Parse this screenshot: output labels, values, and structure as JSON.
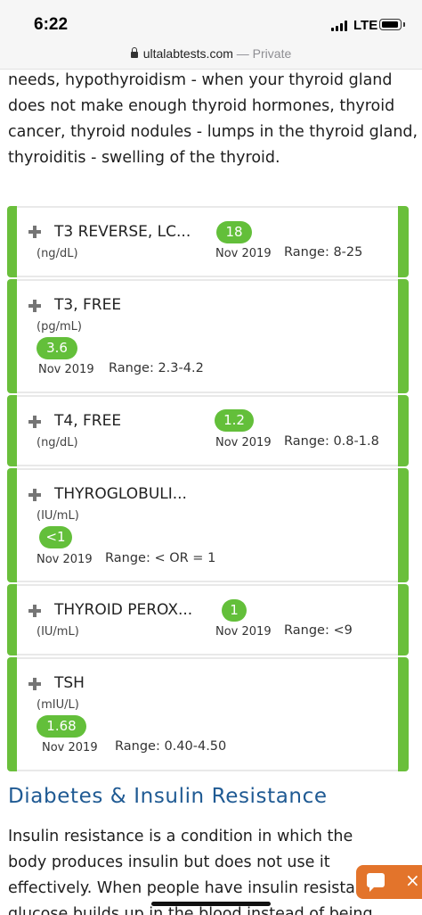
{
  "status_bar": {
    "time": "6:22",
    "network": "LTE"
  },
  "browser": {
    "domain": "ultalabtests.com",
    "mode": "— Private"
  },
  "intro_text": "needs, hypothyroidism - when your thyroid gland does not make enough thyroid hormones, thyroid cancer, thyroid nodules - lumps in the thyroid gland, thyroiditis - swelling of the thyroid.",
  "results": [
    {
      "name": "T3 REVERSE, LC...",
      "unit": "(ng/dL)",
      "value": "18",
      "date": "Nov 2019",
      "range": "Range: 8-25"
    },
    {
      "name": "T3, FREE",
      "unit": "(pg/mL)",
      "value": "3.6",
      "date": "Nov 2019",
      "range": "Range: 2.3-4.2"
    },
    {
      "name": "T4, FREE",
      "unit": "(ng/dL)",
      "value": "1.2",
      "date": "Nov 2019",
      "range": "Range: 0.8-1.8"
    },
    {
      "name": "THYROGLOBULI...",
      "unit": "(IU/mL)",
      "value": "<1",
      "date": "Nov 2019",
      "range": "Range: < OR = 1"
    },
    {
      "name": "THYROID PEROX...",
      "unit": "(IU/mL)",
      "value": "1",
      "date": "Nov 2019",
      "range": "Range: <9"
    },
    {
      "name": "TSH",
      "unit": "(mIU/L)",
      "value": "1.68",
      "date": "Nov 2019",
      "range": "Range: 0.40-4.50"
    }
  ],
  "section": {
    "heading": "Diabetes & Insulin Resistance",
    "paragraph": "Insulin resistance is a condition in which the body produces insulin but does not use it effectively. When people have insulin resistance, glucose builds up in the blood instead of being"
  },
  "chat": {
    "icon": "chat-bubble-icon",
    "close": "×"
  },
  "colors": {
    "accent_green": "#6abf3b",
    "heading_blue": "#1f5a93",
    "chat_orange": "#e3742b"
  }
}
